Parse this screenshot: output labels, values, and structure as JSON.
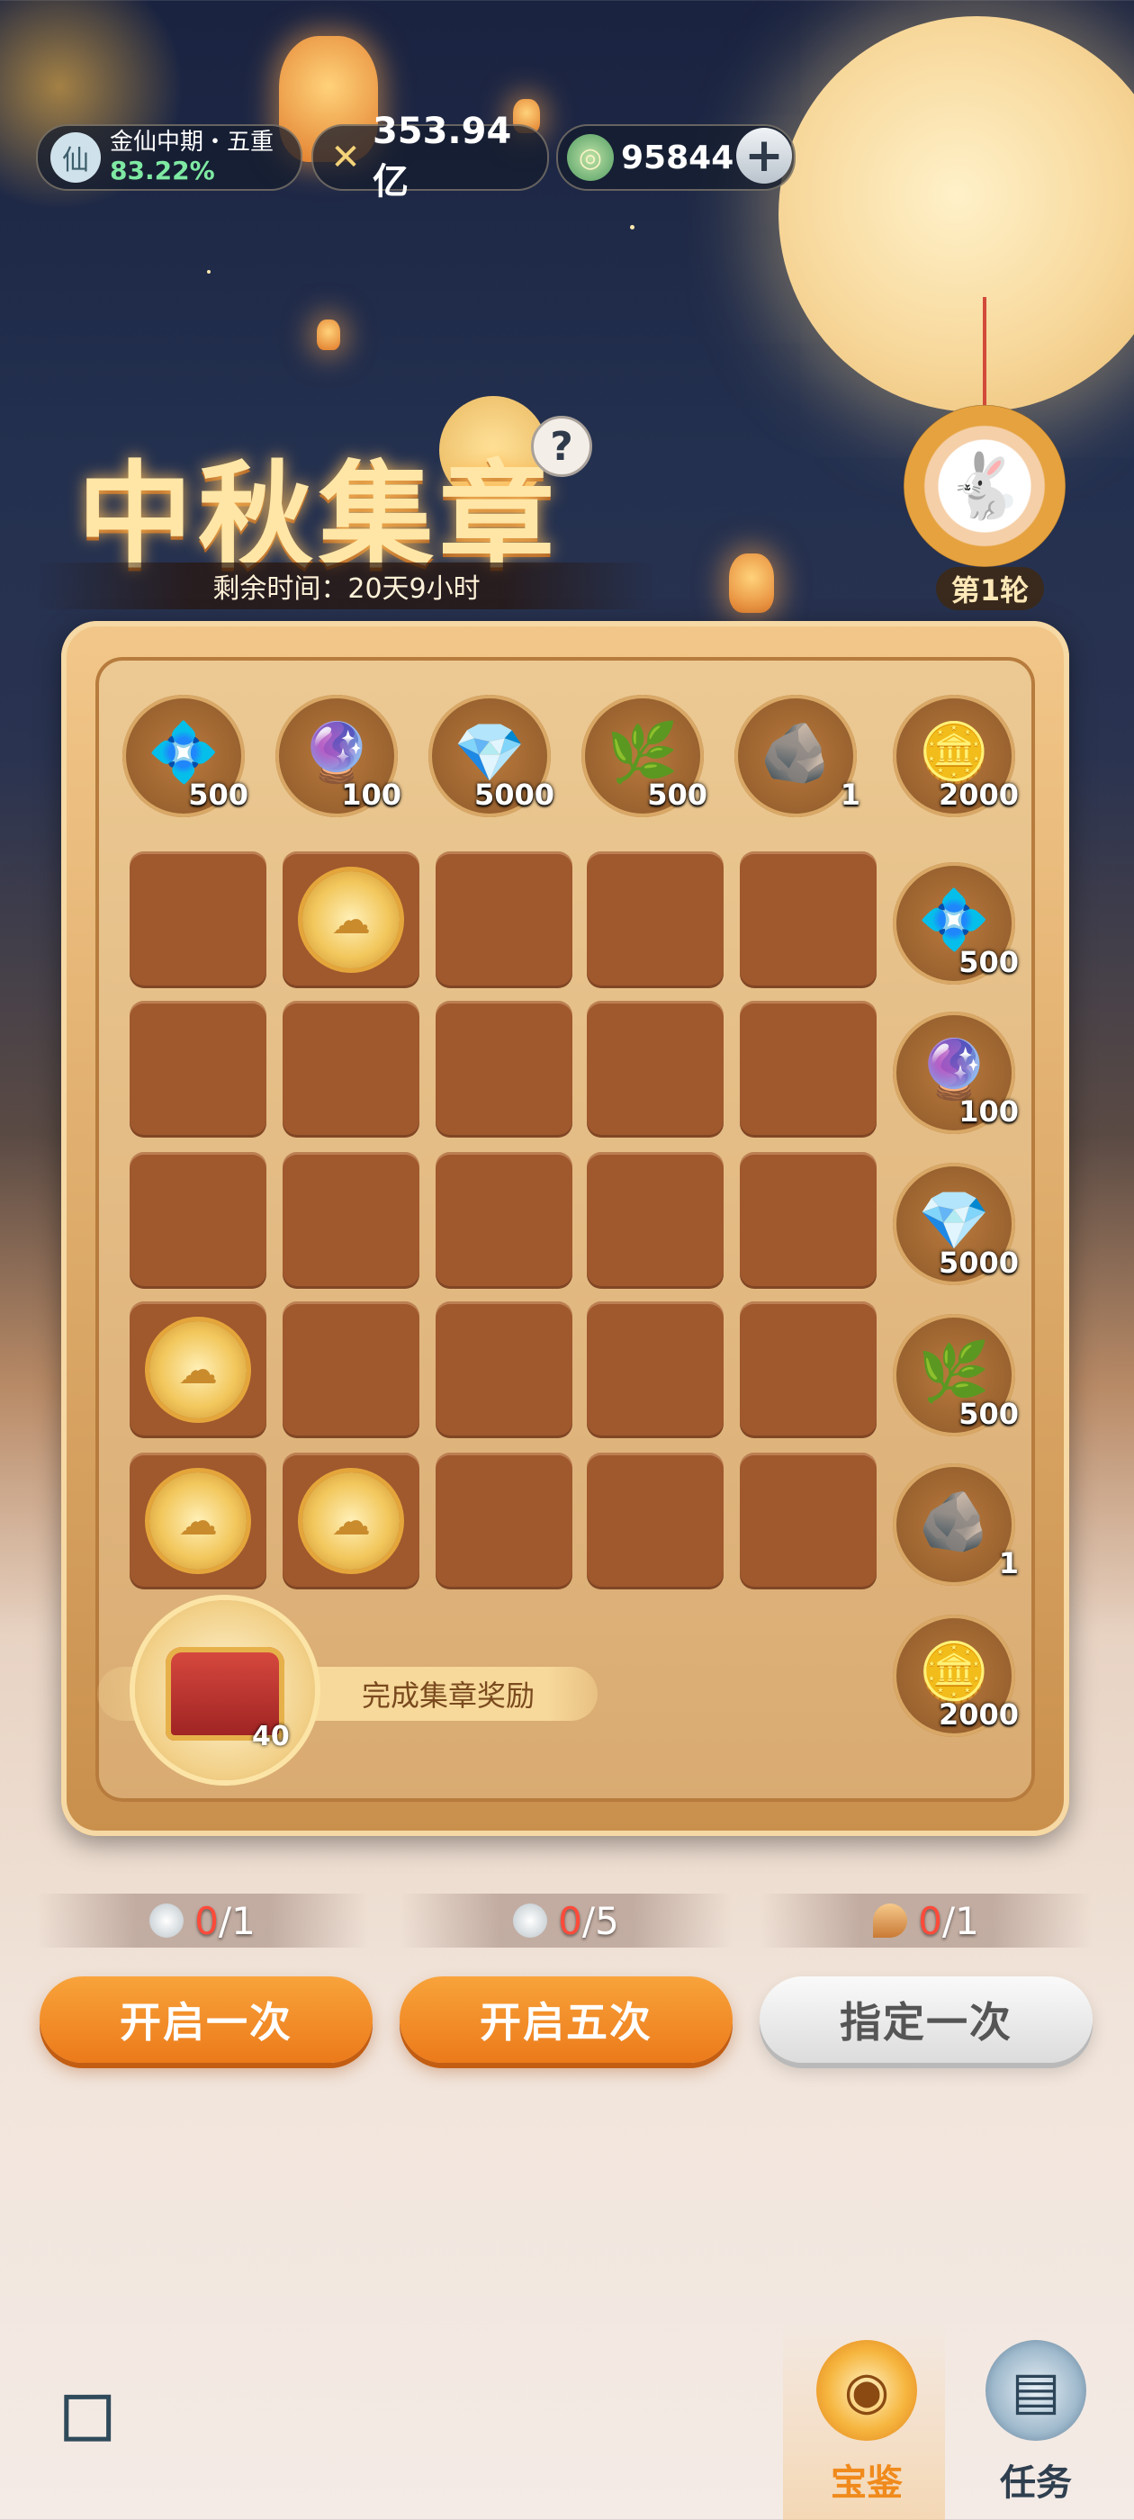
{
  "hud": {
    "realm_name": "金仙中期・五重",
    "realm_progress": "83.22%",
    "combat_power": "353.94亿",
    "jade_currency": "95844",
    "plus_symbol": "+",
    "avatar_icon": "immortal-avatar-icon",
    "power_icon": "crossed-swords-icon",
    "jade_icon": "jade-coin-icon"
  },
  "event": {
    "title": "中秋集章",
    "help_symbol": "?",
    "time_left": "剩余时间：20天9小时",
    "round_label": "第1轮",
    "round_icon": "jade-rabbit-icon"
  },
  "top_rewards": [
    {
      "icon": "blue-chest-icon",
      "glyph": "💠",
      "qty": "500"
    },
    {
      "icon": "purple-crystal-icon",
      "glyph": "🔮",
      "qty": "100"
    },
    {
      "icon": "blue-crystal-icon",
      "glyph": "💎",
      "qty": "5000"
    },
    {
      "icon": "green-jade-icon",
      "glyph": "🌿",
      "qty": "500"
    },
    {
      "icon": "ore-stone-icon",
      "glyph": "🪨",
      "qty": "1"
    },
    {
      "icon": "gold-coin-icon",
      "glyph": "🪙",
      "qty": "2000"
    }
  ],
  "side_rewards": [
    {
      "icon": "blue-chest-icon",
      "glyph": "💠",
      "qty": "500"
    },
    {
      "icon": "purple-crystal-icon",
      "glyph": "🔮",
      "qty": "100"
    },
    {
      "icon": "blue-crystal-icon",
      "glyph": "💎",
      "qty": "5000"
    },
    {
      "icon": "green-jade-icon",
      "glyph": "🌿",
      "qty": "500"
    },
    {
      "icon": "ore-stone-icon",
      "glyph": "🪨",
      "qty": "1"
    },
    {
      "icon": "gold-coin-icon",
      "glyph": "🪙",
      "qty": "2000"
    }
  ],
  "grid_stamps": [
    [
      false,
      true,
      false,
      false,
      false
    ],
    [
      false,
      false,
      false,
      false,
      false
    ],
    [
      false,
      false,
      false,
      false,
      false
    ],
    [
      true,
      false,
      false,
      false,
      false
    ],
    [
      true,
      true,
      false,
      false,
      false
    ]
  ],
  "completion": {
    "label": "完成集章奖励",
    "chest_qty": "40",
    "chest_icon": "red-treasure-chest-icon"
  },
  "actions": [
    {
      "counter_icon": "silver-token-icon",
      "used": "0",
      "total": "/1",
      "label": "开启一次",
      "style": "orange"
    },
    {
      "counter_icon": "silver-token-icon",
      "used": "0",
      "total": "/5",
      "label": "开启五次",
      "style": "orange"
    },
    {
      "counter_icon": "feather-token-icon",
      "used": "0",
      "total": "/1",
      "label": "指定一次",
      "style": "gray"
    }
  ],
  "nav": {
    "treasure_label": "宝鉴",
    "task_label": "任务",
    "treasure_icon": "treasure-mirror-icon",
    "task_icon": "task-scroll-icon",
    "logo_icon": "game-logo-icon"
  },
  "colors": {
    "accent_orange": "#ec7a1a",
    "count_red": "#ff4a3a",
    "progress_green": "#7fe9a3",
    "title_gold": "#ffe6a6"
  }
}
